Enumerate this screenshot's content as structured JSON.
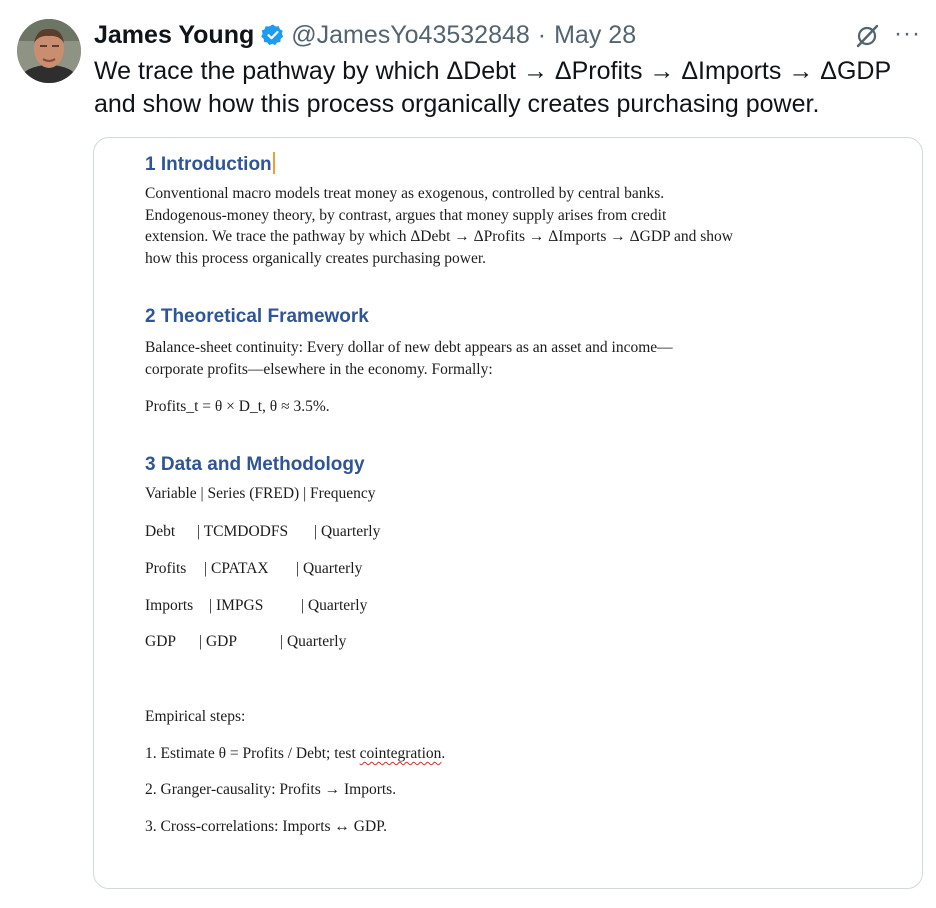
{
  "tweet": {
    "author_name": "James Young",
    "handle": "@JamesYo43532848",
    "separator": "·",
    "date": "May 28",
    "more_label": "···",
    "text_line1": "We trace the pathway by which ΔDebt → ΔProfits → ΔImports → ΔGDP",
    "text_line2": "and show how this process organically creates purchasing power."
  },
  "document": {
    "s1_heading": "1 Introduction",
    "s1_lines": [
      "Conventional macro models treat money as exogenous, controlled by central banks.",
      "Endogenous-money theory, by contrast, argues that money supply arises from credit",
      "extension. We trace the pathway by which ΔDebt → ΔProfits → ΔImports → ΔGDP and show",
      "how this process organically creates purchasing power."
    ],
    "s2_heading": "2 Theoretical Framework",
    "s2_lines": [
      "Balance-sheet continuity: Every dollar of new debt appears as an asset and income—",
      "corporate profits—elsewhere in the economy. Formally:"
    ],
    "formula": "Profits_t = θ × D_t, θ ≈ 3.5%.",
    "s3_heading": "3 Data and Methodology",
    "table_header": "Variable | Series (FRED) | Frequency",
    "table_rows": [
      {
        "var": "Debt",
        "series": "| TCMDODFS",
        "freq": "| Quarterly"
      },
      {
        "var": "Profits",
        "series": "| CPATAX",
        "freq": "| Quarterly"
      },
      {
        "var": "Imports",
        "series": "| IMPGS",
        "freq": "| Quarterly"
      },
      {
        "var": "GDP",
        "series": "| GDP",
        "freq": "| Quarterly"
      }
    ],
    "steps_title": "Empirical steps:",
    "step1_prefix": "1. Estimate θ = Profits / Debt; test ",
    "step1_flagged": "cointegration",
    "step1_suffix": ".",
    "step2": "2. Granger-causality: Profits → Imports.",
    "step3": "3. Cross-correlations: Imports ↔ GDP."
  },
  "colors": {
    "heading": "#2f5597",
    "verified_badge": "#1d9bf0",
    "meta_text": "#536471",
    "card_border": "#cfd9de"
  },
  "icons": [
    "avatar",
    "verified-badge-icon",
    "grok-icon",
    "more-icon"
  ]
}
